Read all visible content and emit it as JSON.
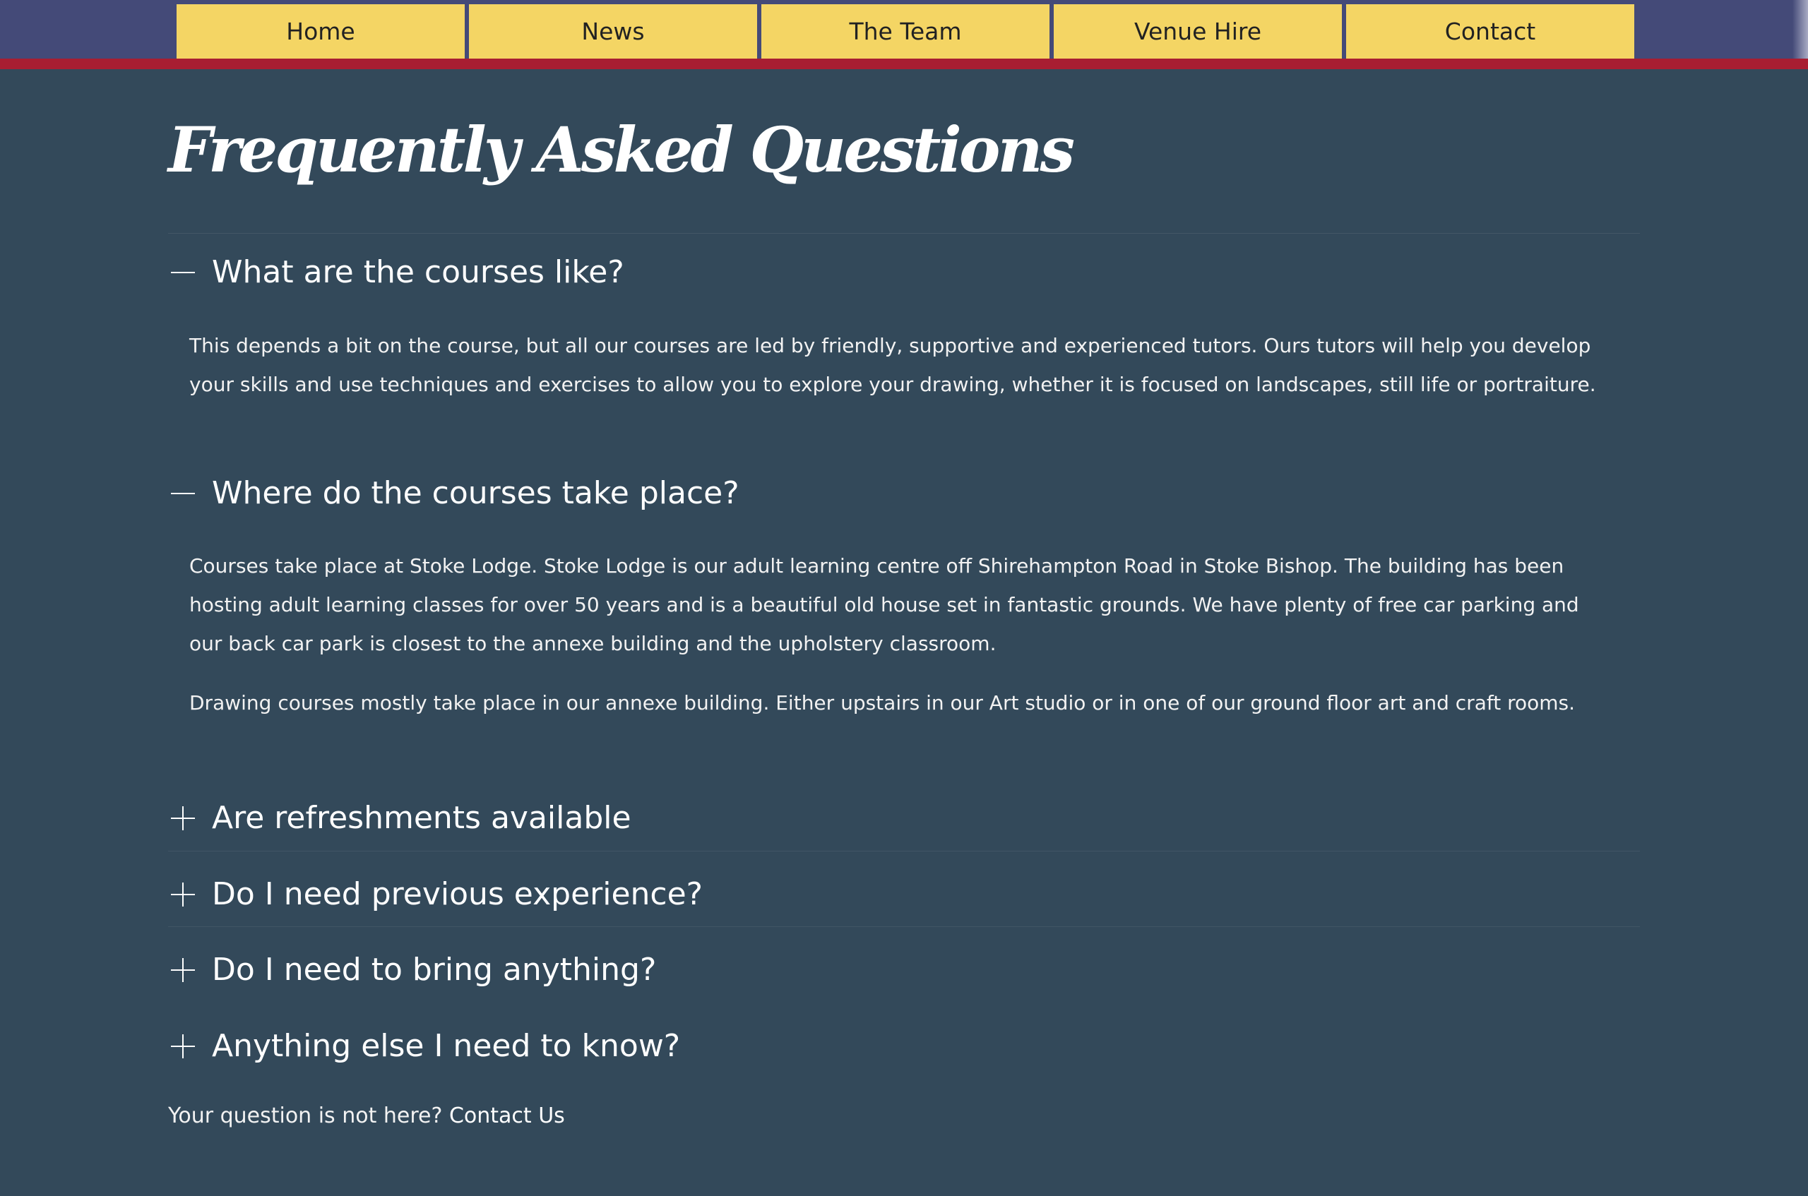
{
  "nav": {
    "items": [
      {
        "label": "Home"
      },
      {
        "label": "News"
      },
      {
        "label": "The Team"
      },
      {
        "label": "Venue Hire"
      },
      {
        "label": "Contact"
      }
    ]
  },
  "page": {
    "title": "Frequently Asked Questions"
  },
  "faq": [
    {
      "question": "What are the courses like?",
      "expanded": true,
      "answer": [
        "This depends a bit on the course, but all our courses are led by friendly, supportive and experienced tutors. Ours tutors will help you develop your skills and use techniques and exercises to allow you to explore your drawing, whether it is focused on landscapes, still life or portraiture."
      ]
    },
    {
      "question": "Where do the courses take place?",
      "expanded": true,
      "answer": [
        "Courses take place at Stoke Lodge.  Stoke Lodge is our adult learning centre off Shirehampton Road in Stoke Bishop. The building has been hosting adult learning classes for over 50 years and is a beautiful old house set in fantastic grounds. We have plenty of free car parking and our back car park is closest to the annexe building and the upholstery classroom.",
        "Drawing courses mostly take place in our annexe building.  Either upstairs in our Art studio or in one of our ground floor art and craft rooms."
      ]
    },
    {
      "question": "Are refreshments available",
      "expanded": false
    },
    {
      "question": "Do I need previous experience?",
      "expanded": false
    },
    {
      "question": "Do I need to bring anything?",
      "expanded": false
    },
    {
      "question": "Anything else I need to know?",
      "expanded": false
    }
  ],
  "footer": {
    "prompt": "Your question is not here?",
    "link": "Contact Us"
  },
  "colors": {
    "background": "#33495a",
    "topbar": "#444a78",
    "nav_item": "#f4d564",
    "accent_line": "#a81e32"
  }
}
